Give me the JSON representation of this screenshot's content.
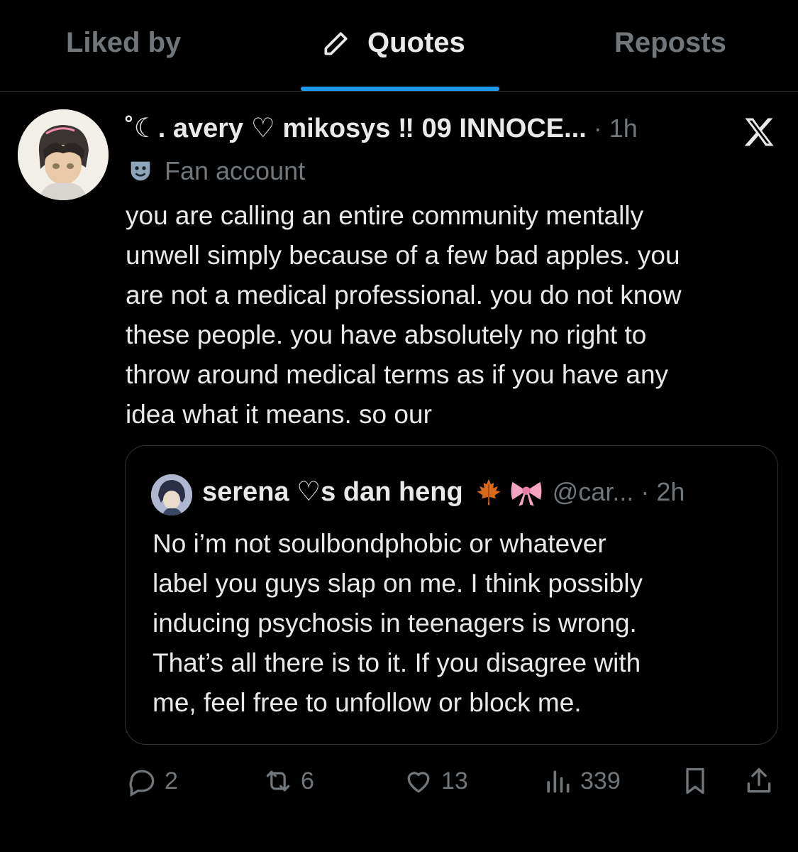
{
  "tabs": [
    {
      "label": "Liked by",
      "active": false
    },
    {
      "label": "Quotes",
      "active": true,
      "icon": "pencil-icon"
    },
    {
      "label": "Reposts",
      "active": false
    }
  ],
  "post": {
    "display_name": "˚☾. avery ♡ mikosys ‼ 09 INNOCE...",
    "time": "· 1h",
    "label": "Fan account",
    "label_icon": "theater-mask-icon",
    "text": "you are calling an entire community mentally\nunwell simply because of a few bad apples. you\nare not a medical professional. you do not know\nthese people. you have absolutely no right to\nthrow around medical terms as if you have any\nidea what it means. so our"
  },
  "quoted_post": {
    "display_name": "serena ♡s dan heng",
    "emojis": [
      "maple-leaf-icon",
      "ribbon-icon"
    ],
    "handle_time": "@car... · 2h",
    "text": "No i’m not soulbondphobic or whatever\nlabel you guys slap on me. I think possibly\ninducing psychosis in teenagers is wrong.\nThat’s all there is to it. If you disagree with\nme, feel free to unfollow or block me."
  },
  "actions": {
    "replies": "2",
    "reposts": "6",
    "likes": "13",
    "views": "339"
  },
  "colors": {
    "background": "#000000",
    "text": "#e7e9ea",
    "muted": "#71767b",
    "accent": "#1d9bf0",
    "border": "#2f3336"
  }
}
